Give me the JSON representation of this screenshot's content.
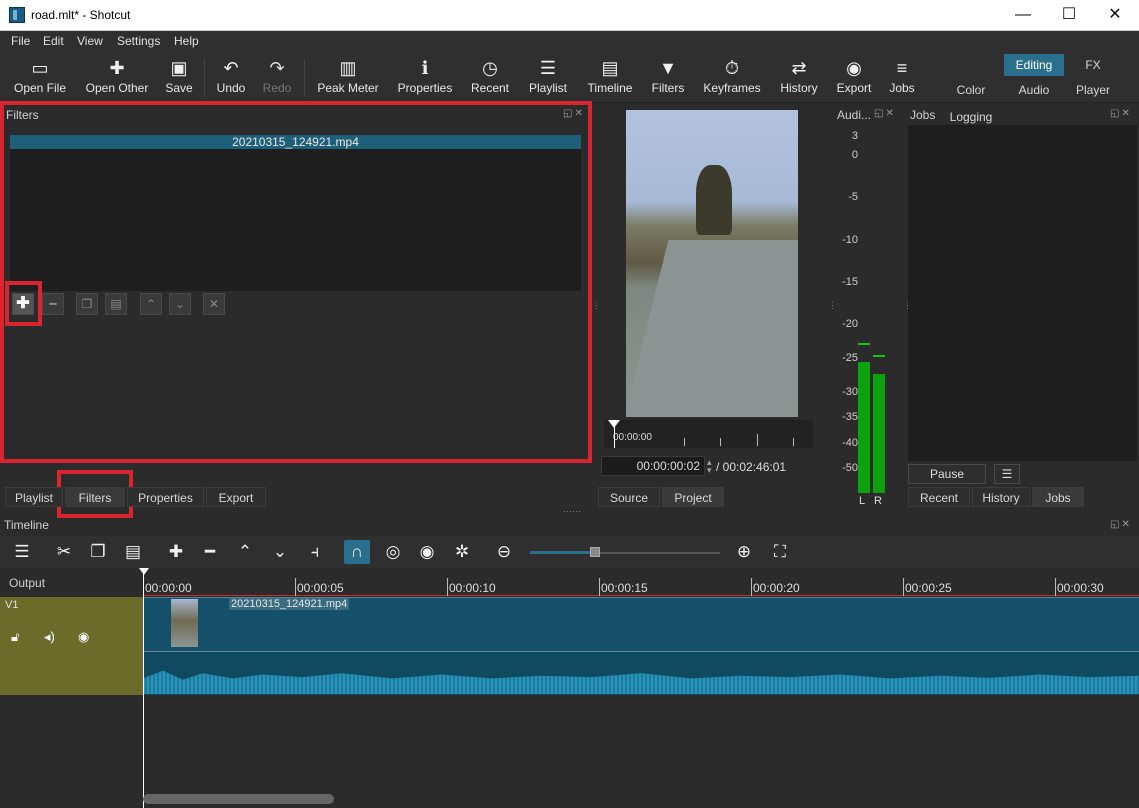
{
  "window": {
    "title": "road.mlt* - Shotcut",
    "minimize": "—",
    "maximize": "☐",
    "close": "✕"
  },
  "menu": [
    "File",
    "Edit",
    "View",
    "Settings",
    "Help"
  ],
  "toolbar": {
    "open_file": "Open File",
    "open_other": "Open Other",
    "save": "Save",
    "undo": "Undo",
    "redo": "Redo",
    "peak_meter": "Peak Meter",
    "properties": "Properties",
    "recent": "Recent",
    "playlist": "Playlist",
    "timeline": "Timeline",
    "filters": "Filters",
    "keyframes": "Keyframes",
    "history": "History",
    "export": "Export",
    "jobs": "Jobs"
  },
  "layouts": {
    "logging": "Logging",
    "editing": "Editing",
    "fx": "FX",
    "color": "Color",
    "audio": "Audio",
    "player": "Player",
    "active": "Editing"
  },
  "filters_panel": {
    "title": "Filters",
    "selected_clip": "20210315_124921.mp4",
    "buttons": [
      "add",
      "remove",
      "copy",
      "paste",
      "move-up",
      "move-down",
      "deselect"
    ]
  },
  "left_tabs": [
    "Playlist",
    "Filters",
    "Properties",
    "Export"
  ],
  "player": {
    "current_time": "00:00:00:02",
    "duration": "/ 00:02:46:01",
    "scrub_start": "00:00:00",
    "tabs": [
      "Source",
      "Project"
    ]
  },
  "audio_meter": {
    "title": "Audi...",
    "scale": [
      "3",
      "0",
      "-5",
      "-10",
      "-15",
      "-20",
      "-25",
      "-30",
      "-35",
      "-40",
      "-50"
    ],
    "channels": [
      "L",
      "R"
    ],
    "level_db": {
      "L": -33,
      "R": -35
    },
    "peak_db": {
      "L": -30,
      "R": -32
    }
  },
  "jobs_panel": {
    "title": "Jobs",
    "pause": "Pause",
    "menu": "☰",
    "tabs": [
      "Recent",
      "History",
      "Jobs"
    ]
  },
  "timeline": {
    "title": "Timeline",
    "output_label": "Output",
    "track": "V1",
    "clip_name": "20210315_124921.mp4",
    "ruler": [
      "00:00:00",
      "00:00:05",
      "00:00:10",
      "00:00:15",
      "00:00:20",
      "00:00:25",
      "00:00:30"
    ]
  },
  "colors": {
    "accent": "#2b6f8e",
    "highlight": "#d8252f",
    "track": "#6b6b2a",
    "clip": "#14506a"
  }
}
